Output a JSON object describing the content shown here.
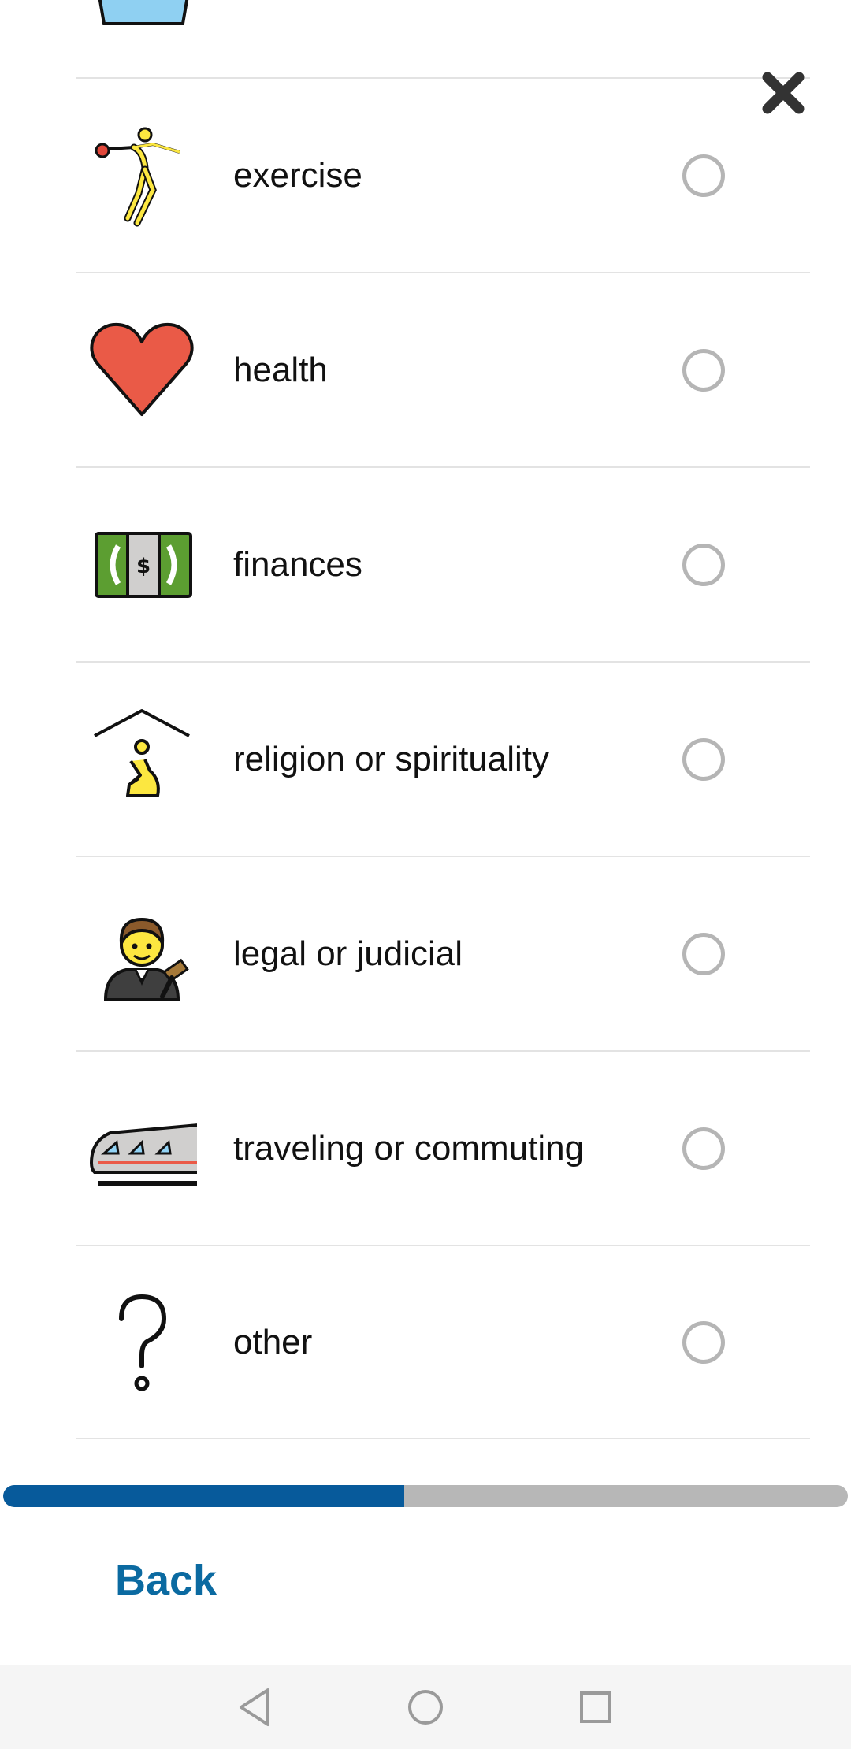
{
  "close_button": {
    "icon": "close-x-icon"
  },
  "options": [
    {
      "label": "exercise",
      "icon": "person-exercise-icon",
      "selected": false
    },
    {
      "label": "health",
      "icon": "heart-icon",
      "selected": false
    },
    {
      "label": "finances",
      "icon": "money-bill-icon",
      "selected": false
    },
    {
      "label": "religion or spirituality",
      "icon": "place-of-worship-icon",
      "selected": false
    },
    {
      "label": "legal or judicial",
      "icon": "judge-icon",
      "selected": false
    },
    {
      "label": "traveling or commuting",
      "icon": "train-icon",
      "selected": false
    },
    {
      "label": "other",
      "icon": "question-mark-icon",
      "selected": false
    }
  ],
  "progress": {
    "fraction": 0.475,
    "fill_color": "#075a9b",
    "track_color": "#b7b7b7"
  },
  "back_button": {
    "label": "Back",
    "color": "#0b6aa1"
  },
  "nav_bar": {
    "buttons": [
      "back-triangle-icon",
      "home-circle-icon",
      "recents-square-icon"
    ]
  }
}
